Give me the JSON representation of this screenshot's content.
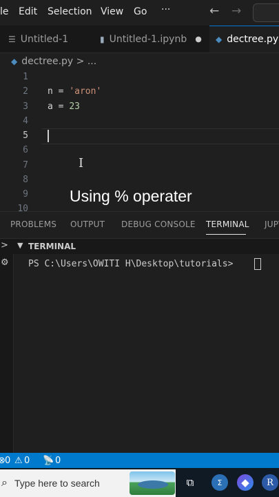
{
  "menubar": {
    "items": [
      "le",
      "Edit",
      "Selection",
      "View",
      "Go"
    ],
    "more": "···",
    "back_arrow": "←",
    "forward_arrow": "→"
  },
  "tabs": [
    {
      "label": "Untitled-1",
      "icon": "lines-icon",
      "active": false
    },
    {
      "label": "Untitled-1.ipynb",
      "icon": "notebook-icon",
      "active": false,
      "dirty": "●"
    },
    {
      "label": "dectree.py",
      "icon": "python-icon",
      "active": true
    }
  ],
  "breadcrumb": "dectree.py > ...",
  "editor": {
    "line_numbers": [
      "1",
      "2",
      "3",
      "4",
      "5",
      "6",
      "7",
      "8",
      "9",
      "10"
    ],
    "active_line": "5",
    "lines": [
      {
        "var": "n",
        "op": " = ",
        "value": "'aron'"
      },
      {
        "var": "a",
        "op": " = ",
        "value": "23"
      }
    ]
  },
  "caption": "Using % operater",
  "panel": {
    "tabs": [
      "PROBLEMS",
      "OUTPUT",
      "DEBUG CONSOLE",
      "TERMINAL",
      "JUPY"
    ],
    "active_tab": "TERMINAL",
    "section_title": "TERMINAL",
    "prompt": "PS C:\\Users\\OWITI H\\Desktop\\tutorials> "
  },
  "statusbar": {
    "errors": "0",
    "warnings": "0",
    "ports": "0"
  },
  "taskbar": {
    "search_placeholder": "Type here to search"
  },
  "colors": {
    "accent": "#007acc",
    "string": "#ce9178",
    "number": "#b5cea8"
  }
}
